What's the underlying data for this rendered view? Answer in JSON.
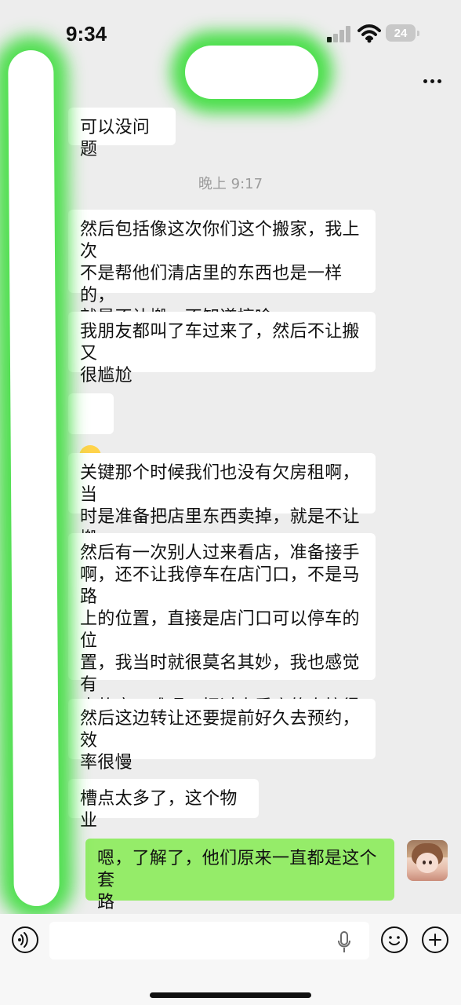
{
  "status": {
    "time": "9:34",
    "battery": "24"
  },
  "header": {
    "more_icon": "more-icon"
  },
  "messages": {
    "top": "可以没问题",
    "timestamp": "晚上 9:17",
    "m1": "然后包括像这次你们这个搬家，我上次\n不是帮他们清店里的东西也是一样的，\n就是不让搬，不知道搞啥",
    "m2": "我朋友都叫了车过来了，然后不让搬又\n很尴尬",
    "m3_emoji": "crying-laughing-emoji",
    "m4": "关键那个时候我们也没有欠房租啊，当\n时是准备把店里东西卖掉，就是不让搬",
    "m5": "然后有一次别人过来看店，准备接手\n啊，还不让我停车在店门口，不是马路\n上的位置，直接是店门口可以停车的位\n置，我当时就很莫名其妙，我也感觉有\n点故意刁难呢，把过来看店的人搞得有\n点生气了，我也很尴尬",
    "m6": "然后这边转让还要提前好久去预约，效\n率很慢",
    "m7": "槽点太多了，这个物业",
    "outgoing": "嗯，了解了，他们原来一直都是这个套\n路"
  },
  "input": {
    "voice_icon": "voice-icon",
    "mic_icon": "mic-icon",
    "emoji_icon": "emoji-icon",
    "plus_icon": "plus-icon"
  },
  "colors": {
    "background": "#ededed",
    "incoming_bubble": "#ffffff",
    "outgoing_bubble": "#95ec69",
    "redaction_glow": "#3edd3e"
  }
}
